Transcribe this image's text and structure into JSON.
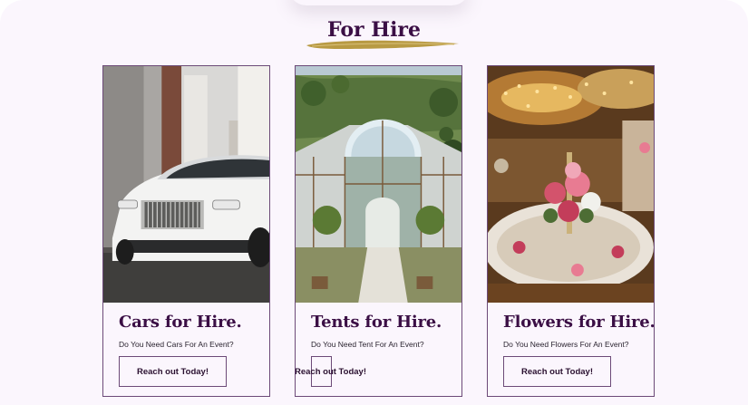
{
  "section": {
    "title": "For Hire"
  },
  "colors": {
    "accent": "#3b0f45",
    "brush": "#b89a43",
    "border": "#6c4a78",
    "background": "#fbf6fd"
  },
  "cards": [
    {
      "title": "Cars for Hire.",
      "subtitle": "Do You Need Cars For An Event?",
      "button": "Reach out Today!",
      "image": "white-rolls-royce-car"
    },
    {
      "title": "Tents for Hire.",
      "subtitle": "Do You Need Tent For An Event?",
      "button": "Reach out Today!",
      "image": "glass-event-tent"
    },
    {
      "title": "Flowers for Hire.",
      "subtitle": "Do You Need Flowers For An Event?",
      "button": "Reach out Today!",
      "image": "flower-decorated-banquet-hall"
    }
  ]
}
